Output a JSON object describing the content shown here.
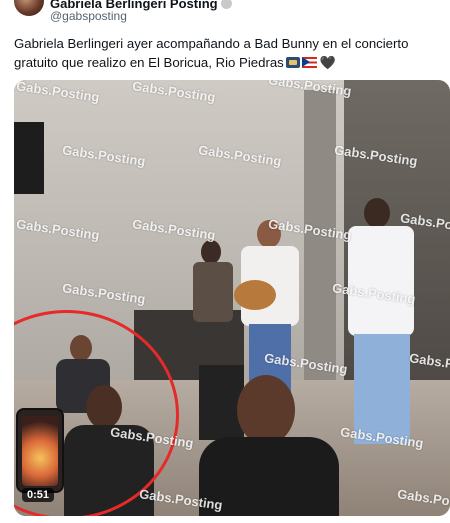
{
  "author": {
    "display_name": "Gabriela Berlingeri Posting",
    "handle": "@gabsposting"
  },
  "tweet": {
    "text": "Gabriela Berlingeri ayer acompañando a Bad Bunny en el concierto gratuito que realizo en El Boricua, Rio Piedras",
    "emojis": [
      "photo-emoji",
      "puerto-rico-flag-emoji",
      "black-heart-emoji"
    ]
  },
  "media": {
    "watermark": "Gabs.Posting",
    "duration": "0:51",
    "highlight_color": "#e52a2a"
  }
}
